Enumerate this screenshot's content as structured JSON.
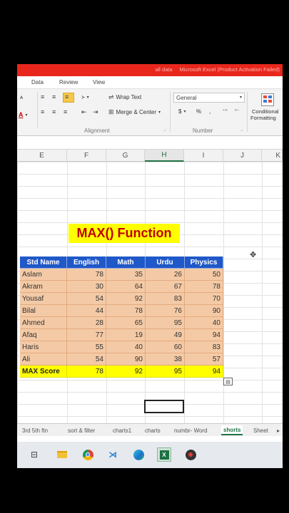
{
  "titlebar": {
    "doc": "all data",
    "app": "Microsoft Excel (Product Activation Failed)"
  },
  "menu": {
    "items": [
      "Data",
      "Review",
      "View"
    ]
  },
  "ribbon": {
    "wrap_text": "Wrap Text",
    "merge_center": "Merge & Center",
    "number_format": "General",
    "alignment_label": "Alignment",
    "number_label": "Number",
    "conditional": "Conditional",
    "formatting": "Formatting",
    "currency": "$",
    "percent": "%",
    "comma": ","
  },
  "columns": [
    "E",
    "F",
    "G",
    "H",
    "I",
    "J",
    "K"
  ],
  "selected_column": "H",
  "function_title": "MAX() Function",
  "table": {
    "headers": [
      "Std Name",
      "English",
      "Math",
      "Urdu",
      "Physics"
    ],
    "rows": [
      [
        "Aslam",
        "78",
        "35",
        "26",
        "50"
      ],
      [
        "Akram",
        "30",
        "64",
        "67",
        "78"
      ],
      [
        "Yousaf",
        "54",
        "92",
        "83",
        "70"
      ],
      [
        "Bilal",
        "44",
        "78",
        "76",
        "90"
      ],
      [
        "Ahmed",
        "28",
        "65",
        "95",
        "40"
      ],
      [
        "Afaq",
        "77",
        "19",
        "49",
        "94"
      ],
      [
        "Haris",
        "55",
        "40",
        "60",
        "83"
      ],
      [
        "Ali",
        "54",
        "90",
        "38",
        "57"
      ]
    ],
    "max_row": [
      "MAX Score",
      "78",
      "92",
      "95",
      "94"
    ]
  },
  "sheet_tabs": [
    "3rd 5th ftn",
    "sort & filter",
    "charts1",
    "charts",
    "numbr- Word",
    "shorts",
    "Sheet"
  ],
  "active_sheet": "shorts",
  "colors": {
    "title_bar": "#e8261c",
    "header_blue": "#1f58c8",
    "body_peach": "#f4caa6",
    "max_yellow": "#ffff00",
    "title_red": "#c00000"
  }
}
